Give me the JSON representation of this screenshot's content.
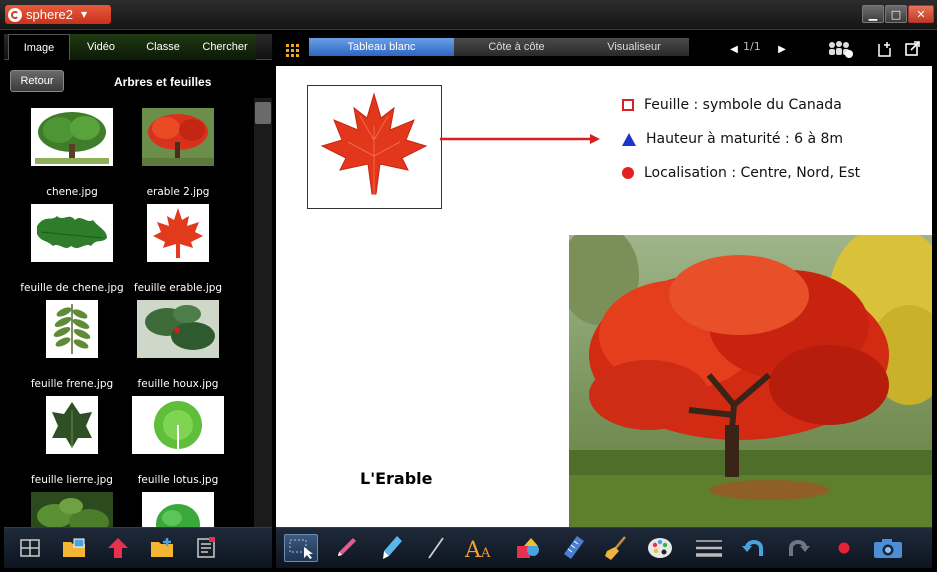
{
  "app": {
    "name": "sphere2",
    "window_controls": [
      "minimize",
      "maximize",
      "close"
    ]
  },
  "left_panel": {
    "tabs": [
      {
        "label": "Image",
        "active": true
      },
      {
        "label": "Vidéo",
        "active": false
      },
      {
        "label": "Classe",
        "active": false
      },
      {
        "label": "Chercher",
        "active": false
      }
    ],
    "back_label": "Retour",
    "folder_title": "Arbres et feuilles",
    "files": [
      {
        "name": "chene.jpg",
        "icon": "oak-tree-thumbnail"
      },
      {
        "name": "erable 2.jpg",
        "icon": "red-maple-tree-thumbnail"
      },
      {
        "name": "feuille de chene.jpg",
        "icon": "oak-leaf-thumbnail"
      },
      {
        "name": "feuille erable.jpg",
        "icon": "maple-leaf-thumbnail"
      },
      {
        "name": "feuille frene.jpg",
        "icon": "ash-leaf-thumbnail"
      },
      {
        "name": "feuille houx.jpg",
        "icon": "holly-leaf-thumbnail"
      },
      {
        "name": "feuille lierre.jpg",
        "icon": "ivy-leaf-thumbnail"
      },
      {
        "name": "feuille lotus.jpg",
        "icon": "lotus-leaf-thumbnail"
      },
      {
        "name": "",
        "icon": "leaf-thumbnail"
      },
      {
        "name": "",
        "icon": "mint-leaf-thumbnail"
      }
    ],
    "bottom_tools": [
      "layout-icon",
      "folder-image-icon",
      "upload-arrow-icon",
      "new-folder-icon",
      "properties-icon"
    ]
  },
  "board": {
    "tabs": [
      {
        "label": "Tableau blanc",
        "active": true
      },
      {
        "label": "Côte à côte",
        "active": false
      },
      {
        "label": "Visualiseur",
        "active": false
      }
    ],
    "page_indicator": "1/1",
    "header_icons": [
      "prev-page-icon",
      "next-page-icon",
      "users-icon",
      "add-page-icon",
      "export-icon"
    ],
    "info": [
      {
        "marker": "square",
        "color": "#d8212a",
        "text": "Feuille : symbole du Canada"
      },
      {
        "marker": "triangle",
        "color": "#1e35c9",
        "text": "Hauteur à maturité : 6 à 8m"
      },
      {
        "marker": "dot",
        "color": "#e41f1f",
        "text": "Localisation : Centre, Nord, Est"
      }
    ],
    "title": "L'Erable",
    "tools": [
      "select-icon",
      "pen-icon",
      "highlighter-icon",
      "line-icon",
      "text-icon",
      "shapes-icon",
      "ruler-icon",
      "eraser-broom-icon",
      "color-palette-icon",
      "line-width-icon",
      "undo-icon",
      "redo-icon",
      "record-icon",
      "camera-icon"
    ]
  }
}
